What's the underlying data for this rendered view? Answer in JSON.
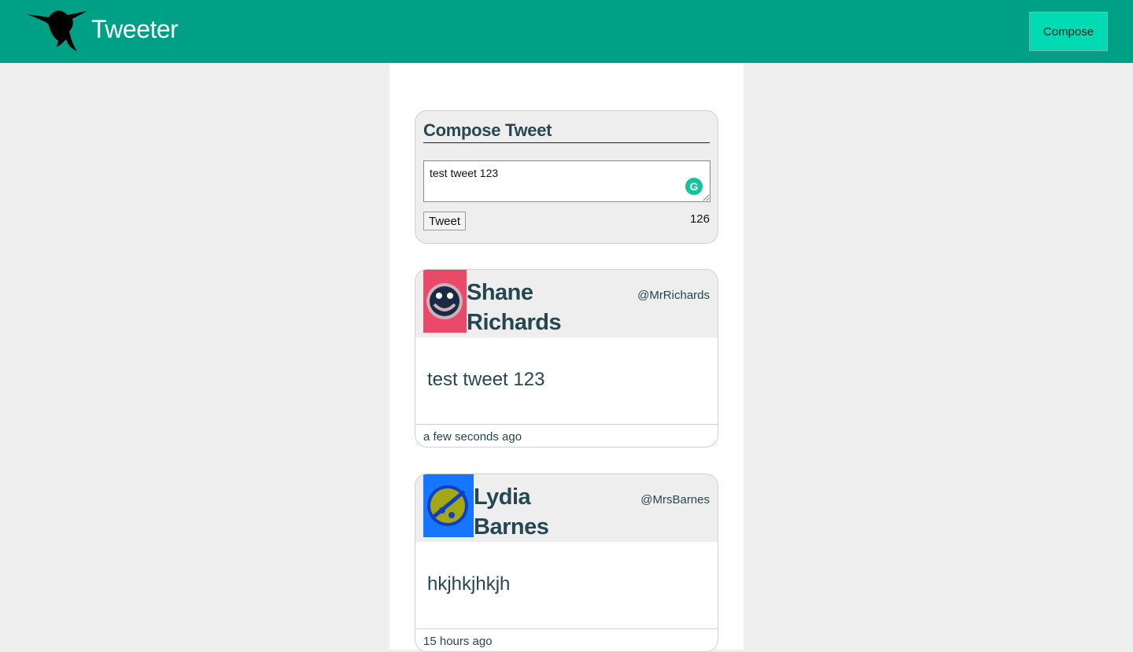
{
  "nav": {
    "brand": "Tweeter",
    "compose_label": "Compose",
    "logo_icon": "hummingbird-icon"
  },
  "compose": {
    "heading": "Compose Tweet",
    "text_value": "test tweet 123",
    "tweet_label": "Tweet",
    "counter": "126",
    "grammarly_icon": "grammarly-icon"
  },
  "tweets": [
    {
      "name": "Shane Richards",
      "handle": "@MrRichards",
      "text": "test tweet 123",
      "time": "a few seconds ago",
      "avatar_bg": "#e94a6a",
      "avatar_fg": "#1b2a44"
    },
    {
      "name": "Lydia Barnes",
      "handle": "@MrsBarnes",
      "text": "hkjhkjhkjh",
      "time": "15 hours ago",
      "avatar_bg": "#1776ff",
      "avatar_fg": "#a3a815"
    }
  ],
  "colors": {
    "navbar": "#00a087",
    "compose_button": "#00dbb3",
    "text": "#244751",
    "background": "#eeeeee"
  }
}
